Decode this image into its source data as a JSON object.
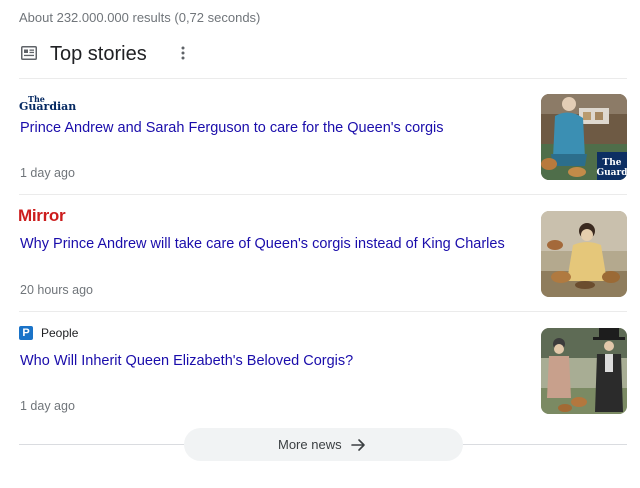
{
  "results_count": "About 232.000.000 results (0,72 seconds)",
  "section": {
    "title": "Top stories",
    "icon": "news-icon",
    "menu_icon": "more-vert-icon"
  },
  "stories": [
    {
      "source": "The Guardian",
      "source_logo_top": "The",
      "source_logo_bottom": "Guardian",
      "headline": "Prince Andrew and Sarah Ferguson to care for the Queen's corgis",
      "time": "1 day ago",
      "thumb_caption_top": "The",
      "thumb_caption_bottom": "Guard"
    },
    {
      "source": "Mirror",
      "headline": "Why Prince Andrew will take care of Queen's corgis instead of King Charles",
      "time": "20 hours ago"
    },
    {
      "source": "People",
      "source_letter": "P",
      "headline": "Who Will Inherit Queen Elizabeth's Beloved Corgis?",
      "time": "1 day ago"
    }
  ],
  "more_news": {
    "label": "More news",
    "icon": "arrow-right-icon"
  },
  "colors": {
    "link": "#1a0dab",
    "meta": "#70757a",
    "mirror_red": "#cc1d1d",
    "people_blue": "#1a73c8"
  }
}
